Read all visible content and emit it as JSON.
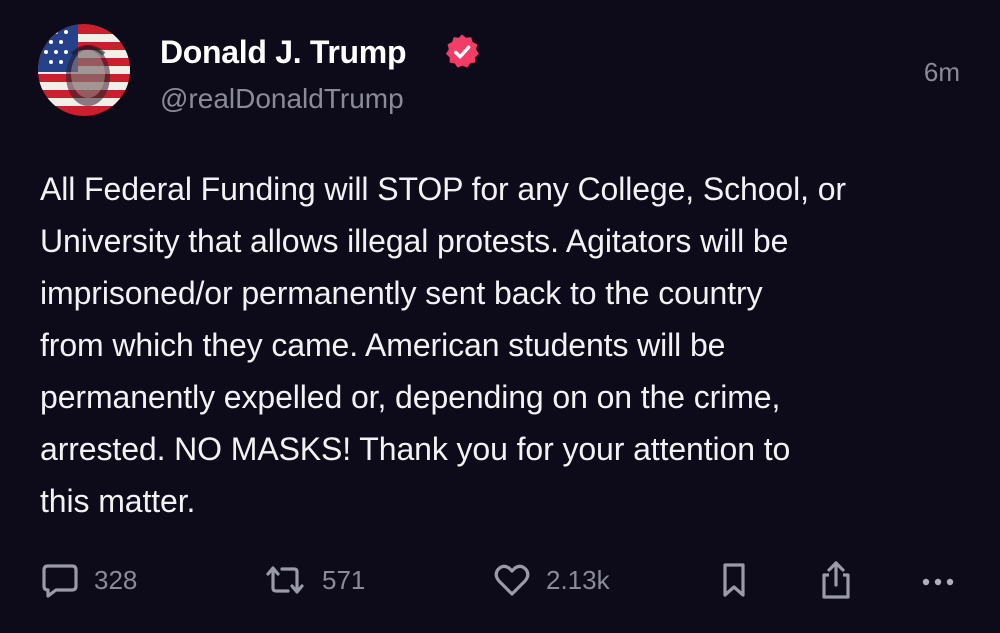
{
  "post": {
    "display_name": "Donald J. Trump",
    "handle": "@realDonaldTrump",
    "timestamp": "6m",
    "verified": true,
    "text": "All Federal Funding will STOP for any College, School, or\nUniversity that allows illegal protests. Agitators will be\nimprisoned/or permanently sent back to the country\nfrom which they came. American students will be\npermanently expelled or, depending on on the crime,\narrested. NO MASKS! Thank you for your attention to\nthis matter."
  },
  "actions": {
    "replies": "328",
    "reposts": "571",
    "likes": "2.13k"
  },
  "icons": {
    "reply": "speech-bubble-icon",
    "repost": "repost-icon",
    "like": "heart-icon",
    "bookmark": "bookmark-icon",
    "share": "share-icon",
    "more": "more-icon",
    "verified": "verified-badge-icon"
  },
  "colors": {
    "background": "#0d0b1a",
    "verified_badge": "#f23d66",
    "secondary_text": "#8a8a98"
  }
}
